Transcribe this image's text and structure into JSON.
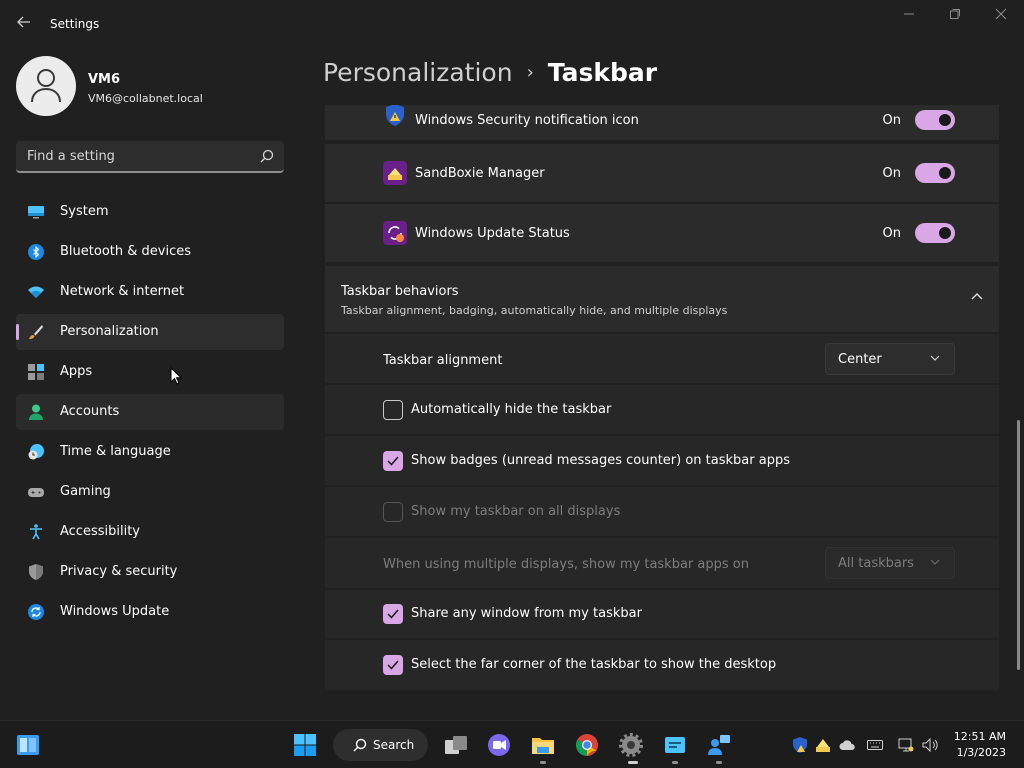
{
  "window": {
    "title": "Settings"
  },
  "profile": {
    "name": "VM6",
    "email": "VM6@collabnet.local"
  },
  "search": {
    "placeholder": "Find a setting"
  },
  "sidebar": {
    "items": [
      {
        "label": "System",
        "icon": "monitor-icon"
      },
      {
        "label": "Bluetooth & devices",
        "icon": "bluetooth-icon"
      },
      {
        "label": "Network & internet",
        "icon": "wifi-icon"
      },
      {
        "label": "Personalization",
        "icon": "brush-icon",
        "selected": true
      },
      {
        "label": "Apps",
        "icon": "apps-icon"
      },
      {
        "label": "Accounts",
        "icon": "person-icon"
      },
      {
        "label": "Time & language",
        "icon": "clock-globe-icon"
      },
      {
        "label": "Gaming",
        "icon": "gamepad-icon"
      },
      {
        "label": "Accessibility",
        "icon": "accessibility-icon"
      },
      {
        "label": "Privacy & security",
        "icon": "shield-icon"
      },
      {
        "label": "Windows Update",
        "icon": "update-icon"
      }
    ]
  },
  "breadcrumb": {
    "parent": "Personalization",
    "separator": "›",
    "current": "Taskbar"
  },
  "tray_apps": [
    {
      "label": "Windows Security notification icon",
      "state": "On"
    },
    {
      "label": "SandBoxie Manager",
      "state": "On"
    },
    {
      "label": "Windows Update Status",
      "state": "On"
    }
  ],
  "behaviors": {
    "title": "Taskbar behaviors",
    "subtitle": "Taskbar alignment, badging, automatically hide, and multiple displays",
    "alignment_label": "Taskbar alignment",
    "alignment_value": "Center",
    "auto_hide": "Automatically hide the taskbar",
    "badges": "Show badges (unread messages counter) on taskbar apps",
    "all_displays": "Show my taskbar on all displays",
    "multi_display_label": "When using multiple displays, show my taskbar apps on",
    "multi_display_value": "All taskbars",
    "share_window": "Share any window from my taskbar",
    "far_corner": "Select the far corner of the taskbar to show the desktop"
  },
  "taskbar": {
    "search_label": "Search"
  },
  "clock": {
    "time": "12:51 AM",
    "date": "1/3/2023"
  },
  "colors": {
    "accent": "#d9a6e6",
    "background": "#202020",
    "card": "#2b2b2b"
  }
}
